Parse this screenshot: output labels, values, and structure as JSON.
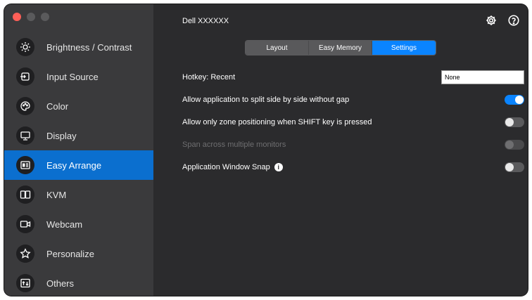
{
  "window": {
    "title": "Dell XXXXXX"
  },
  "sidebar": {
    "items": [
      {
        "label": "Brightness / Contrast",
        "icon": "sun-icon",
        "active": false
      },
      {
        "label": "Input Source",
        "icon": "input-source-icon",
        "active": false
      },
      {
        "label": "Color",
        "icon": "color-palette-icon",
        "active": false
      },
      {
        "label": "Display",
        "icon": "monitor-icon",
        "active": false
      },
      {
        "label": "Easy Arrange",
        "icon": "easy-arrange-icon",
        "active": true
      },
      {
        "label": "KVM",
        "icon": "kvm-icon",
        "active": false
      },
      {
        "label": "Webcam",
        "icon": "webcam-icon",
        "active": false
      },
      {
        "label": "Personalize",
        "icon": "star-icon",
        "active": false
      },
      {
        "label": "Others",
        "icon": "others-icon",
        "active": false
      }
    ]
  },
  "header": {
    "icons": [
      "gear-icon",
      "help-icon"
    ]
  },
  "tabs": [
    {
      "label": "Layout",
      "selected": false
    },
    {
      "label": "Easy Memory",
      "selected": false
    },
    {
      "label": "Settings",
      "selected": true
    }
  ],
  "settings": {
    "hotkey": {
      "label": "Hotkey: Recent",
      "value": "None"
    },
    "split_gap": {
      "label": "Allow application to split side by side without gap",
      "on": true
    },
    "shift_zone": {
      "label": "Allow only zone positioning when SHIFT key is pressed",
      "on": false
    },
    "span_monitors": {
      "label": "Span across multiple monitors",
      "on": false,
      "disabled": true
    },
    "window_snap": {
      "label": "Application Window Snap",
      "info_glyph": "i",
      "on": false
    }
  },
  "colors": {
    "accent": "#0a84ff",
    "sidebar_active": "#0b6fcf"
  }
}
